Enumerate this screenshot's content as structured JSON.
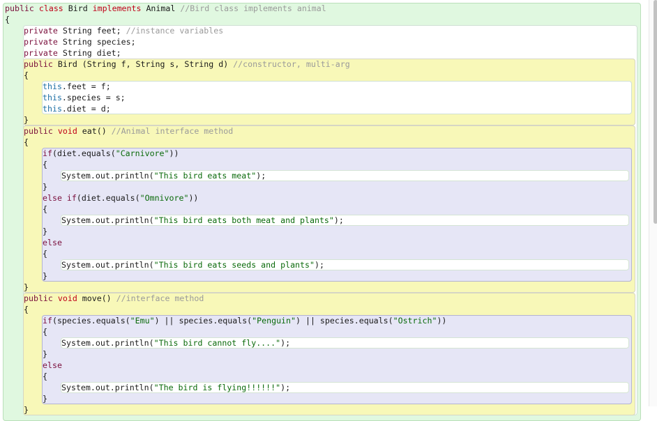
{
  "colors": {
    "class_bg": "#e0f8e0",
    "method_bg": "#f8f8b8",
    "statement_bg": "#e6e6f6",
    "body_bg": "#ffffff"
  },
  "scroll": {
    "thumb_fraction": 0.55
  },
  "code": {
    "box": "green",
    "name": "class-block",
    "items": [
      {
        "t": [
          [
            "mod",
            "public "
          ],
          [
            "kw",
            "class "
          ],
          [
            "txt",
            "Bird "
          ],
          [
            "kw",
            "implements "
          ],
          [
            "txt",
            "Animal "
          ],
          [
            "com",
            "//Bird class implements animal"
          ]
        ]
      },
      {
        "t": [
          [
            "txt",
            "{"
          ]
        ]
      },
      {
        "box": "white",
        "name": "class-body",
        "items": [
          {
            "t": [
              [
                "mod",
                "private "
              ],
              [
                "txt",
                "String feet; "
              ],
              [
                "com",
                "//instance variables"
              ]
            ]
          },
          {
            "t": [
              [
                "mod",
                "private "
              ],
              [
                "txt",
                "String species;"
              ]
            ]
          },
          {
            "t": [
              [
                "mod",
                "private "
              ],
              [
                "txt",
                "String diet;"
              ]
            ]
          },
          {
            "box": "yellow",
            "name": "constructor-block",
            "items": [
              {
                "t": [
                  [
                    "mod",
                    "public "
                  ],
                  [
                    "txt",
                    "Bird (String f, String s, String d) "
                  ],
                  [
                    "com",
                    "//constructor, multi-arg"
                  ]
                ]
              },
              {
                "t": [
                  [
                    "txt",
                    "{"
                  ]
                ]
              },
              {
                "box": "white",
                "name": "constructor-body",
                "items": [
                  {
                    "t": [
                      [
                        "this",
                        "this"
                      ],
                      [
                        "txt",
                        ".feet = f;"
                      ]
                    ]
                  },
                  {
                    "t": [
                      [
                        "this",
                        "this"
                      ],
                      [
                        "txt",
                        ".species = s;"
                      ]
                    ]
                  },
                  {
                    "t": [
                      [
                        "this",
                        "this"
                      ],
                      [
                        "txt",
                        ".diet = d;"
                      ]
                    ]
                  }
                ]
              },
              {
                "t": [
                  [
                    "txt",
                    "}"
                  ]
                ]
              }
            ]
          },
          {
            "box": "yellow",
            "name": "method-eat-block",
            "items": [
              {
                "t": [
                  [
                    "mod",
                    "public "
                  ],
                  [
                    "kw",
                    "void "
                  ],
                  [
                    "txt",
                    "eat() "
                  ],
                  [
                    "com",
                    "//Animal interface method"
                  ]
                ]
              },
              {
                "t": [
                  [
                    "txt",
                    "{"
                  ]
                ]
              },
              {
                "box": "lav",
                "name": "if-statement-block",
                "items": [
                  {
                    "t": [
                      [
                        "mod",
                        "if"
                      ],
                      [
                        "txt",
                        "(diet.equals("
                      ],
                      [
                        "str",
                        "\"Carnivore\""
                      ],
                      [
                        "txt",
                        "))"
                      ]
                    ]
                  },
                  {
                    "t": [
                      [
                        "txt",
                        "{"
                      ]
                    ]
                  },
                  {
                    "box": "stmt",
                    "name": "statement-body",
                    "items": [
                      {
                        "t": [
                          [
                            "txt",
                            "System.out.println("
                          ],
                          [
                            "str",
                            "\"This bird eats meat\""
                          ],
                          [
                            "txt",
                            ");"
                          ]
                        ]
                      }
                    ]
                  },
                  {
                    "t": [
                      [
                        "txt",
                        "}"
                      ]
                    ]
                  },
                  {
                    "t": [
                      [
                        "mod",
                        "else if"
                      ],
                      [
                        "txt",
                        "(diet.equals("
                      ],
                      [
                        "str",
                        "\"Omnivore\""
                      ],
                      [
                        "txt",
                        "))"
                      ]
                    ]
                  },
                  {
                    "t": [
                      [
                        "txt",
                        "{"
                      ]
                    ]
                  },
                  {
                    "box": "stmt",
                    "name": "statement-body",
                    "items": [
                      {
                        "t": [
                          [
                            "txt",
                            "System.out.println("
                          ],
                          [
                            "str",
                            "\"This bird eats both meat and plants\""
                          ],
                          [
                            "txt",
                            ");"
                          ]
                        ]
                      }
                    ]
                  },
                  {
                    "t": [
                      [
                        "txt",
                        "}"
                      ]
                    ]
                  },
                  {
                    "t": [
                      [
                        "mod",
                        "else"
                      ]
                    ]
                  },
                  {
                    "t": [
                      [
                        "txt",
                        "{"
                      ]
                    ]
                  },
                  {
                    "box": "stmt",
                    "name": "statement-body",
                    "items": [
                      {
                        "t": [
                          [
                            "txt",
                            "System.out.println("
                          ],
                          [
                            "str",
                            "\"This bird eats seeds and plants\""
                          ],
                          [
                            "txt",
                            ");"
                          ]
                        ]
                      }
                    ]
                  },
                  {
                    "t": [
                      [
                        "txt",
                        "}"
                      ]
                    ]
                  }
                ]
              },
              {
                "t": [
                  [
                    "txt",
                    "}"
                  ]
                ]
              }
            ]
          },
          {
            "box": "yellow",
            "name": "method-move-block",
            "items": [
              {
                "t": [
                  [
                    "mod",
                    "public "
                  ],
                  [
                    "kw",
                    "void "
                  ],
                  [
                    "txt",
                    "move() "
                  ],
                  [
                    "com",
                    "//interface method"
                  ]
                ]
              },
              {
                "t": [
                  [
                    "txt",
                    "{"
                  ]
                ]
              },
              {
                "box": "lav",
                "name": "if-statement-block",
                "items": [
                  {
                    "t": [
                      [
                        "mod",
                        "if"
                      ],
                      [
                        "txt",
                        "(species.equals("
                      ],
                      [
                        "str",
                        "\"Emu\""
                      ],
                      [
                        "txt",
                        ") || species.equals("
                      ],
                      [
                        "str",
                        "\"Penguin\""
                      ],
                      [
                        "txt",
                        ") || species.equals("
                      ],
                      [
                        "str",
                        "\"Ostrich\""
                      ],
                      [
                        "txt",
                        "))"
                      ]
                    ]
                  },
                  {
                    "t": [
                      [
                        "txt",
                        "{"
                      ]
                    ]
                  },
                  {
                    "box": "stmt",
                    "name": "statement-body",
                    "items": [
                      {
                        "t": [
                          [
                            "txt",
                            "System.out.println("
                          ],
                          [
                            "str",
                            "\"This bird cannot fly....\""
                          ],
                          [
                            "txt",
                            ");"
                          ]
                        ]
                      }
                    ]
                  },
                  {
                    "t": [
                      [
                        "txt",
                        "}"
                      ]
                    ]
                  },
                  {
                    "t": [
                      [
                        "mod",
                        "else"
                      ]
                    ]
                  },
                  {
                    "t": [
                      [
                        "txt",
                        "{"
                      ]
                    ]
                  },
                  {
                    "box": "stmt",
                    "name": "statement-body",
                    "items": [
                      {
                        "t": [
                          [
                            "txt",
                            "System.out.println("
                          ],
                          [
                            "str",
                            "\"The bird is flying!!!!!!\""
                          ],
                          [
                            "txt",
                            ");"
                          ]
                        ]
                      }
                    ]
                  },
                  {
                    "t": [
                      [
                        "txt",
                        "}"
                      ]
                    ]
                  }
                ]
              },
              {
                "t": [
                  [
                    "txt",
                    "}"
                  ]
                ]
              }
            ]
          }
        ]
      }
    ]
  }
}
